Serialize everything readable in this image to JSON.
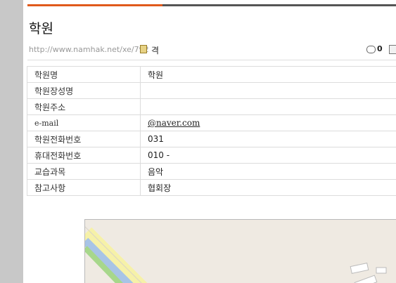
{
  "page": {
    "title": "학원",
    "url": "http://www.namhak.net/xe/792",
    "url_suffix": "격",
    "comment_count": "0"
  },
  "table": {
    "rows": [
      {
        "label": "학원명",
        "value": "학원"
      },
      {
        "label": "학원장성명",
        "value": ""
      },
      {
        "label": "학원주소",
        "value": ""
      },
      {
        "label": "e-mail",
        "value": "@naver.com"
      },
      {
        "label": "학원전화번호",
        "value": "031"
      },
      {
        "label": "휴대전화번호",
        "value": "010 -"
      },
      {
        "label": "교습과목",
        "value": "음악"
      },
      {
        "label": "참고사항",
        "value": "협회장"
      }
    ]
  },
  "colors": {
    "accent": "#e05a1c",
    "map_road": "#f6f1a8",
    "map_water": "#a8c4e6",
    "map_park": "#a7d78b"
  }
}
